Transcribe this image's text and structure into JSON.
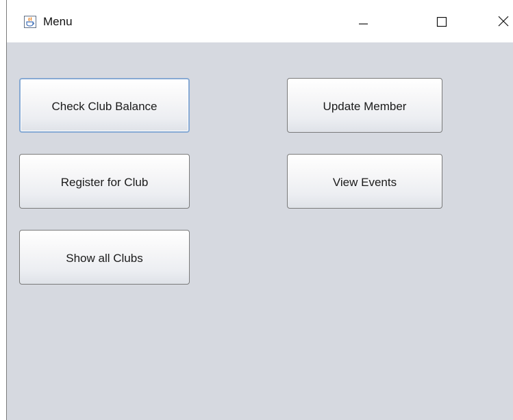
{
  "window": {
    "title": "Menu",
    "icon": "java-coffee-cup-icon",
    "controls": {
      "minimize_icon": "minimize-icon",
      "maximize_icon": "maximize-icon",
      "close_icon": "close-icon"
    }
  },
  "menu": {
    "buttons": [
      {
        "label": "Check Club Balance",
        "focused": true
      },
      {
        "label": "Update Member",
        "focused": false
      },
      {
        "label": "Register for Club",
        "focused": false
      },
      {
        "label": "View Events",
        "focused": false
      },
      {
        "label": "Show all Clubs",
        "focused": false
      }
    ]
  },
  "colors": {
    "window_background": "#d6d9e0",
    "titlebar_background": "#ffffff",
    "focus_ring": "#86a9d3",
    "button_border": "#7a7a7a"
  }
}
